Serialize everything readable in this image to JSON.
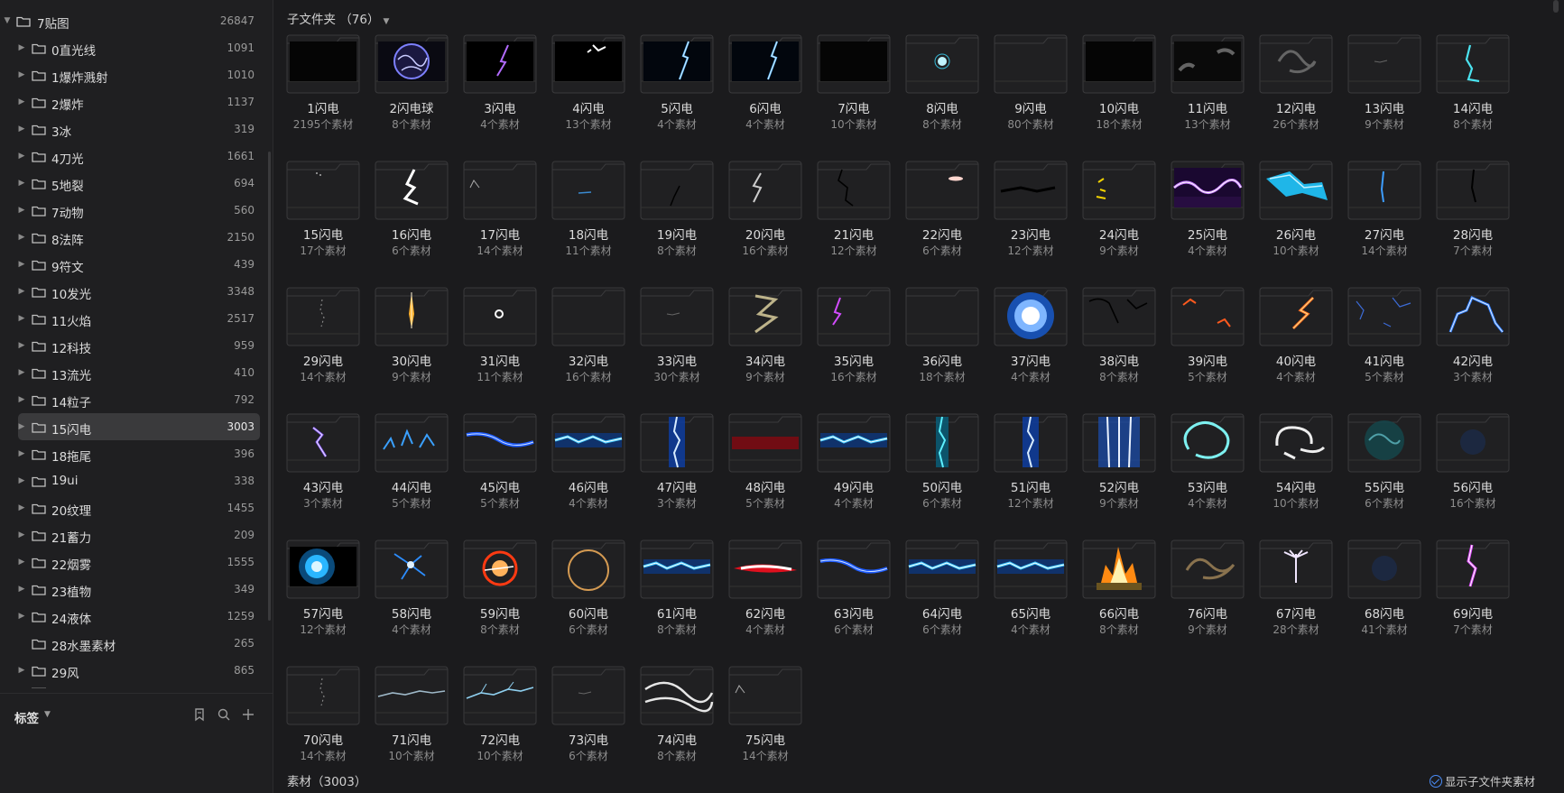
{
  "sidebar": {
    "root": {
      "label": "7贴图",
      "count": "26847"
    },
    "items": [
      {
        "label": "0直光线",
        "count": "1091",
        "expandable": true
      },
      {
        "label": "1爆炸溅射",
        "count": "1010",
        "expandable": true
      },
      {
        "label": "2爆炸",
        "count": "1137",
        "expandable": true
      },
      {
        "label": "3冰",
        "count": "319",
        "expandable": true
      },
      {
        "label": "4刀光",
        "count": "1661",
        "expandable": true
      },
      {
        "label": "5地裂",
        "count": "694",
        "expandable": true
      },
      {
        "label": "7动物",
        "count": "560",
        "expandable": true
      },
      {
        "label": "8法阵",
        "count": "2150",
        "expandable": true
      },
      {
        "label": "9符文",
        "count": "439",
        "expandable": true
      },
      {
        "label": "10发光",
        "count": "3348",
        "expandable": true
      },
      {
        "label": "11火焰",
        "count": "2517",
        "expandable": true
      },
      {
        "label": "12科技",
        "count": "959",
        "expandable": true
      },
      {
        "label": "13流光",
        "count": "410",
        "expandable": true
      },
      {
        "label": "14粒子",
        "count": "792",
        "expandable": true
      },
      {
        "label": "15闪电",
        "count": "3003",
        "expandable": true,
        "selected": true
      },
      {
        "label": "18拖尾",
        "count": "396",
        "expandable": true
      },
      {
        "label": "19ui",
        "count": "338",
        "expandable": true
      },
      {
        "label": "20纹理",
        "count": "1455",
        "expandable": true
      },
      {
        "label": "21蓄力",
        "count": "209",
        "expandable": true
      },
      {
        "label": "22烟雾",
        "count": "1555",
        "expandable": true
      },
      {
        "label": "23植物",
        "count": "349",
        "expandable": true
      },
      {
        "label": "24液体",
        "count": "1259",
        "expandable": true
      },
      {
        "label": "28水墨素材",
        "count": "265",
        "expandable": false
      },
      {
        "label": "29风",
        "count": "865",
        "expandable": true
      }
    ],
    "tags_label": "标签",
    "icons": [
      "caret-down-icon",
      "folder-icon",
      "bookmark-icon",
      "search-icon",
      "plus-icon"
    ]
  },
  "main": {
    "subfolder_header": "子文件夹 （76）",
    "assets_footer": "素材（3003）",
    "show_sub_assets_label": "显示子文件夹素材",
    "accent_color": "#4a8cf7",
    "folders": [
      {
        "title": "1闪电",
        "sub": "2195个素材",
        "style": "black"
      },
      {
        "title": "2闪电球",
        "sub": "8个素材",
        "style": "orb-purple"
      },
      {
        "title": "3闪电",
        "sub": "4个素材",
        "style": "bolt-purple"
      },
      {
        "title": "4闪电",
        "sub": "13个素材",
        "style": "bolt-white-corner"
      },
      {
        "title": "5闪电",
        "sub": "4个素材",
        "style": "bolt-blue-v"
      },
      {
        "title": "6闪电",
        "sub": "4个素材",
        "style": "bolt-blue-v"
      },
      {
        "title": "7闪电",
        "sub": "10个素材",
        "style": "black"
      },
      {
        "title": "8闪电",
        "sub": "8个素材",
        "style": "dot-cyan"
      },
      {
        "title": "9闪电",
        "sub": "80个素材",
        "style": "empty"
      },
      {
        "title": "10闪电",
        "sub": "18个素材",
        "style": "black"
      },
      {
        "title": "11闪电",
        "sub": "13个素材",
        "style": "smoke-dark"
      },
      {
        "title": "12闪电",
        "sub": "26个素材",
        "style": "smoke-grey"
      },
      {
        "title": "13闪电",
        "sub": "9个素材",
        "style": "faint-line"
      },
      {
        "title": "14闪电",
        "sub": "8个素材",
        "style": "bolt-cyan-v"
      },
      {
        "title": "15闪电",
        "sub": "17个素材",
        "style": "faint-dots"
      },
      {
        "title": "16闪电",
        "sub": "6个素材",
        "style": "bolt-white-thick"
      },
      {
        "title": "17闪电",
        "sub": "14个素材",
        "style": "faint-corner"
      },
      {
        "title": "18闪电",
        "sub": "11个素材",
        "style": "faint-blue-line"
      },
      {
        "title": "19闪电",
        "sub": "8个素材",
        "style": "faint-dark-crack"
      },
      {
        "title": "20闪电",
        "sub": "16个素材",
        "style": "bolt-grey"
      },
      {
        "title": "21闪电",
        "sub": "12个素材",
        "style": "dark-crack"
      },
      {
        "title": "22闪电",
        "sub": "6个素材",
        "style": "dot-pink"
      },
      {
        "title": "23闪电",
        "sub": "12个素材",
        "style": "dark-streak"
      },
      {
        "title": "24闪电",
        "sub": "9个素材",
        "style": "yellow-bits"
      },
      {
        "title": "25闪电",
        "sub": "4个素材",
        "style": "band-purple"
      },
      {
        "title": "26闪电",
        "sub": "10个素材",
        "style": "shard-cyan"
      },
      {
        "title": "27闪电",
        "sub": "14个素材",
        "style": "bolt-blue-small"
      },
      {
        "title": "28闪电",
        "sub": "7个素材",
        "style": "dark-vertical"
      },
      {
        "title": "29闪电",
        "sub": "14个素材",
        "style": "faint-dots-v"
      },
      {
        "title": "30闪电",
        "sub": "9个素材",
        "style": "flare-orange"
      },
      {
        "title": "31闪电",
        "sub": "11个素材",
        "style": "ring-white"
      },
      {
        "title": "32闪电",
        "sub": "16个素材",
        "style": "empty"
      },
      {
        "title": "33闪电",
        "sub": "30个素材",
        "style": "faint-line"
      },
      {
        "title": "34闪电",
        "sub": "9个素材",
        "style": "bolt-khaki"
      },
      {
        "title": "35闪电",
        "sub": "16个素材",
        "style": "bolt-magenta"
      },
      {
        "title": "36闪电",
        "sub": "18个素材",
        "style": "empty"
      },
      {
        "title": "37闪电",
        "sub": "4个素材",
        "style": "orb-white"
      },
      {
        "title": "38闪电",
        "sub": "8个素材",
        "style": "dark-crack-wide"
      },
      {
        "title": "39闪电",
        "sub": "5个素材",
        "style": "bolt-red-split"
      },
      {
        "title": "40闪电",
        "sub": "4个素材",
        "style": "bolt-orange"
      },
      {
        "title": "41闪电",
        "sub": "5个素材",
        "style": "bolt-blue-faint"
      },
      {
        "title": "42闪电",
        "sub": "3个素材",
        "style": "bolt-blue-bright"
      },
      {
        "title": "43闪电",
        "sub": "3个素材",
        "style": "bolt-violet"
      },
      {
        "title": "44闪电",
        "sub": "5个素材",
        "style": "bolt-blue-multi"
      },
      {
        "title": "45闪电",
        "sub": "5个素材",
        "style": "band-blue-thin"
      },
      {
        "title": "46闪电",
        "sub": "4个素材",
        "style": "band-blue-bright"
      },
      {
        "title": "47闪电",
        "sub": "3个素材",
        "style": "column-blue"
      },
      {
        "title": "48闪电",
        "sub": "5个素材",
        "style": "band-red"
      },
      {
        "title": "49闪电",
        "sub": "4个素材",
        "style": "band-blue-bright"
      },
      {
        "title": "50闪电",
        "sub": "6个素材",
        "style": "column-cyan"
      },
      {
        "title": "51闪电",
        "sub": "12个素材",
        "style": "column-blue"
      },
      {
        "title": "52闪电",
        "sub": "9个素材",
        "style": "column-wide"
      },
      {
        "title": "53闪电",
        "sub": "4个素材",
        "style": "ring-cyan"
      },
      {
        "title": "54闪电",
        "sub": "10个素材",
        "style": "swirl-white"
      },
      {
        "title": "55闪电",
        "sub": "6个素材",
        "style": "orb-teal"
      },
      {
        "title": "56闪电",
        "sub": "16个素材",
        "style": "faint-blue-glow"
      },
      {
        "title": "57闪电",
        "sub": "12个素材",
        "style": "orb-cyan"
      },
      {
        "title": "58闪电",
        "sub": "4个素材",
        "style": "spark-blue"
      },
      {
        "title": "59闪电",
        "sub": "8个素材",
        "style": "ring-orange"
      },
      {
        "title": "60闪电",
        "sub": "6个素材",
        "style": "ring-gold"
      },
      {
        "title": "61闪电",
        "sub": "8个素材",
        "style": "band-blue-bright"
      },
      {
        "title": "62闪电",
        "sub": "4个素材",
        "style": "band-red-white"
      },
      {
        "title": "63闪电",
        "sub": "6个素材",
        "style": "band-blue-thin"
      },
      {
        "title": "64闪电",
        "sub": "6个素材",
        "style": "band-blue-bright"
      },
      {
        "title": "65闪电",
        "sub": "4个素材",
        "style": "band-blue-bright"
      },
      {
        "title": "66闪电",
        "sub": "8个素材",
        "style": "fire-burst"
      },
      {
        "title": "76闪电",
        "sub": "9个素材",
        "style": "smoke-gold"
      },
      {
        "title": "67闪电",
        "sub": "28个素材",
        "style": "spray-white"
      },
      {
        "title": "68闪电",
        "sub": "41个素材",
        "style": "faint-blue-glow"
      },
      {
        "title": "69闪电",
        "sub": "7个素材",
        "style": "column-pink"
      },
      {
        "title": "70闪电",
        "sub": "14个素材",
        "style": "faint-dots-v"
      },
      {
        "title": "71闪电",
        "sub": "10个素材",
        "style": "line-grey"
      },
      {
        "title": "72闪电",
        "sub": "10个素材",
        "style": "line-grey-blue"
      },
      {
        "title": "73闪电",
        "sub": "6个素材",
        "style": "faint-line"
      },
      {
        "title": "74闪电",
        "sub": "8个素材",
        "style": "swirl-grey"
      },
      {
        "title": "75闪电",
        "sub": "14个素材",
        "style": "faint-corner"
      }
    ]
  }
}
